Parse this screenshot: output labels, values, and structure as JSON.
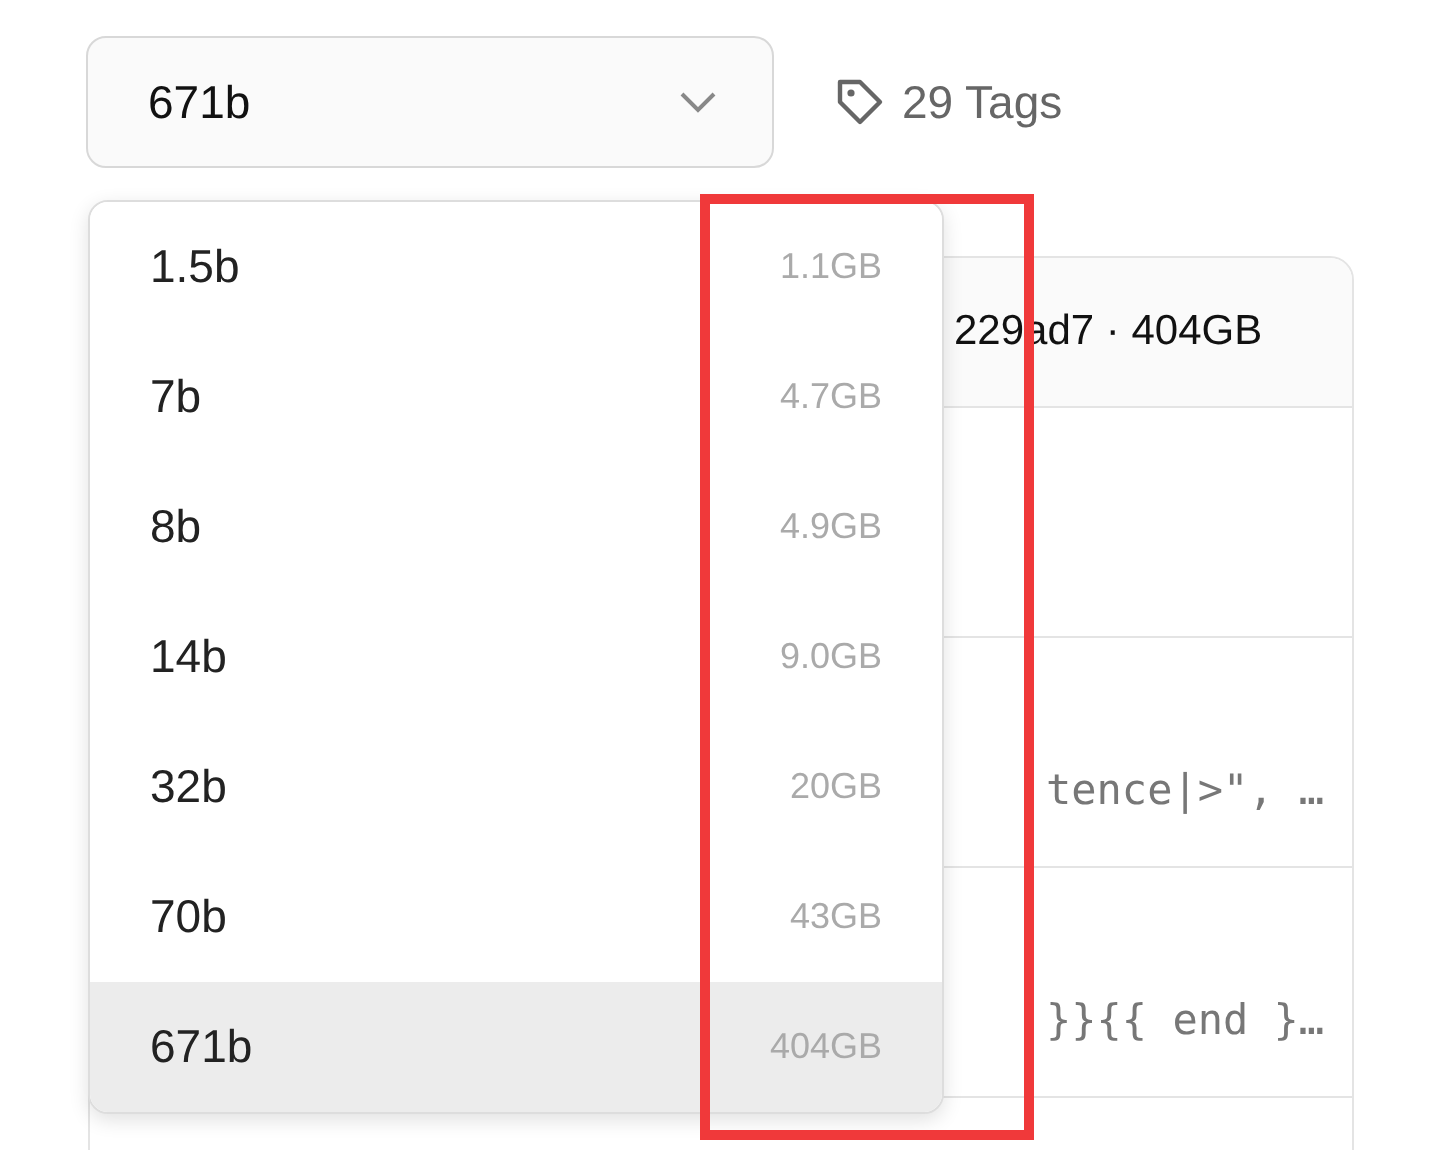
{
  "model_select": {
    "value": "671b"
  },
  "tags": {
    "label": "29 Tags"
  },
  "version_menu": [
    {
      "label": "1.5b",
      "size": "1.1GB",
      "selected": false
    },
    {
      "label": "7b",
      "size": "4.7GB",
      "selected": false
    },
    {
      "label": "8b",
      "size": "4.9GB",
      "selected": false
    },
    {
      "label": "14b",
      "size": "9.0GB",
      "selected": false
    },
    {
      "label": "32b",
      "size": "20GB",
      "selected": false
    },
    {
      "label": "70b",
      "size": "43GB",
      "selected": false
    },
    {
      "label": "671b",
      "size": "404GB",
      "selected": true
    }
  ],
  "file_card": {
    "header": "229ad7 · 404GB",
    "rows": [
      {
        "text": ""
      },
      {
        "text": "tence|>\", …"
      },
      {
        "text": "}}{{ end }…"
      }
    ]
  }
}
